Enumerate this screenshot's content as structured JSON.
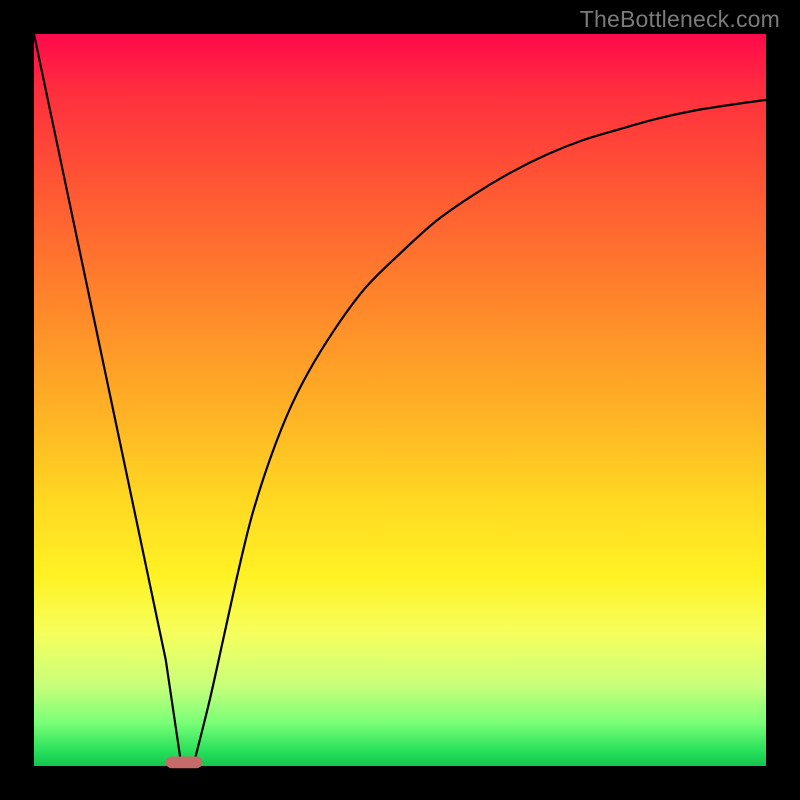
{
  "watermark": "TheBottleneck.com",
  "chart_data": {
    "type": "line",
    "title": "",
    "xlabel": "",
    "ylabel": "",
    "xlim": [
      0,
      100
    ],
    "ylim": [
      0,
      100
    ],
    "grid": false,
    "series": [
      {
        "name": "left-branch",
        "x": [
          0,
          2,
          4,
          6,
          8,
          10,
          12,
          14,
          16,
          18,
          20
        ],
        "y": [
          100,
          90.5,
          81,
          71.5,
          62,
          52.5,
          43,
          33.5,
          24,
          14.5,
          1
        ]
      },
      {
        "name": "right-branch",
        "x": [
          22,
          24,
          26,
          28,
          30,
          33,
          36,
          40,
          45,
          50,
          55,
          60,
          65,
          70,
          75,
          80,
          85,
          90,
          95,
          100
        ],
        "y": [
          1,
          9,
          18,
          27,
          35,
          44,
          51,
          58,
          65,
          70,
          74.5,
          78,
          81,
          83.5,
          85.5,
          87,
          88.4,
          89.5,
          90.3,
          91
        ]
      }
    ],
    "marker": {
      "name": "recommended-range-pill",
      "x_center": 20.5,
      "y": 0.5,
      "width": 5,
      "height": 1.6,
      "color": "#c76a6a"
    },
    "background_gradient": {
      "top": "#ff0a4b",
      "bottom": "#14c44e"
    }
  }
}
